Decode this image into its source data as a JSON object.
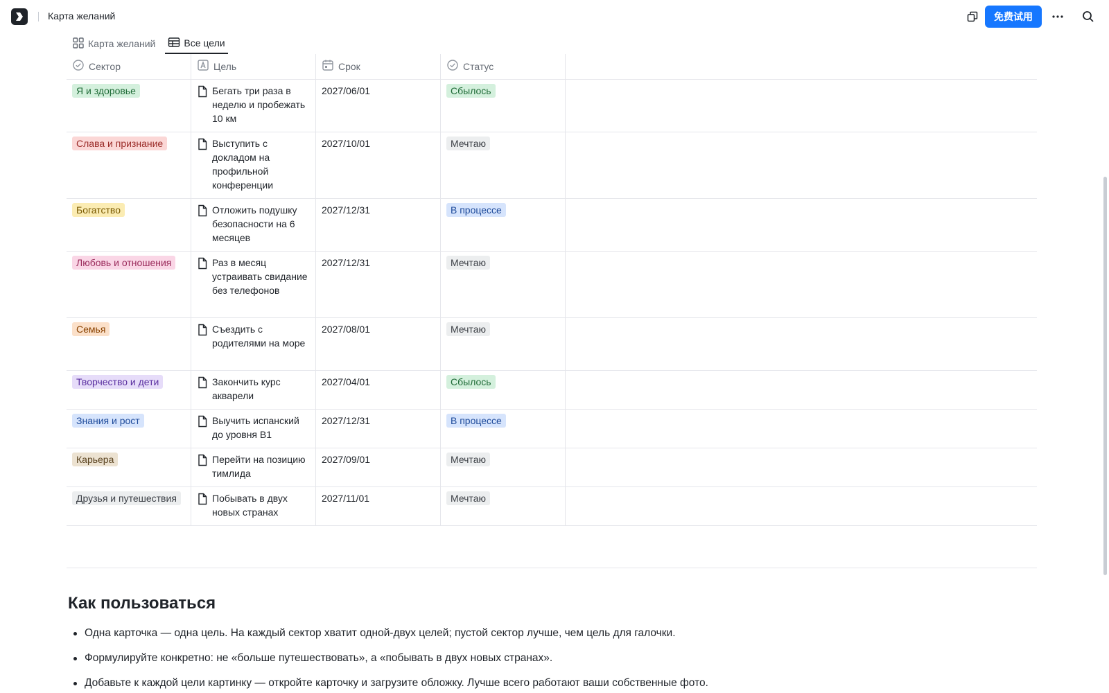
{
  "header": {
    "title": "Карта желаний",
    "try_button": "免费试用",
    "icons": [
      "app-logo-icon",
      "duplicate-icon",
      "more-icon",
      "search-icon"
    ]
  },
  "tabs": [
    {
      "label": "Карта желаний",
      "icon": "grid-icon",
      "active": false
    },
    {
      "label": "Все цели",
      "icon": "table-icon",
      "active": true
    }
  ],
  "table": {
    "columns": [
      {
        "label": "Сектор",
        "icon": "check-circle-icon"
      },
      {
        "label": "Цель",
        "icon": "text-field-icon"
      },
      {
        "label": "Срок",
        "icon": "calendar-icon"
      },
      {
        "label": "Статус",
        "icon": "check-circle-icon"
      }
    ],
    "rows": [
      {
        "sector": "Я и здоровье",
        "sector_color": "#d4f0dd",
        "sector_text": "#1f6b37",
        "goal": "Бегать три раза в неделю и пробежать 10 км",
        "date": "2027/06/01",
        "status": "Сбылось",
        "status_key": "done"
      },
      {
        "sector": "Слава и признание",
        "sector_color": "#fbd7d6",
        "sector_text": "#9a2a27",
        "goal": "Выступить с докладом на профильной конференции",
        "date": "2027/10/01",
        "status": "Мечтаю",
        "status_key": "dream"
      },
      {
        "sector": "Богатство",
        "sector_color": "#fbecb3",
        "sector_text": "#7a5a00",
        "goal": "Отложить подушку безопасности на 6 месяцев",
        "date": "2027/12/31",
        "status": "В процессе",
        "status_key": "progress"
      },
      {
        "sector": "Любовь и отношения",
        "sector_color": "#fad6e6",
        "sector_text": "#9a2a5b",
        "goal": "Раз в месяц устраивать свидание без телефонов",
        "date": "2027/12/31",
        "status": "Мечтаю",
        "status_key": "dream"
      },
      {
        "sector": "Семья",
        "sector_color": "#fbe0c9",
        "sector_text": "#8a4200",
        "goal": "Съездить с родителями на море",
        "date": "2027/08/01",
        "status": "Мечтаю",
        "status_key": "dream"
      },
      {
        "sector": "Творчество и дети",
        "sector_color": "#e6dcf9",
        "sector_text": "#5a2fa0",
        "goal": "Закончить курс акварели",
        "date": "2027/04/01",
        "status": "Сбылось",
        "status_key": "done"
      },
      {
        "sector": "Знания и рост",
        "sector_color": "#d6e4fc",
        "sector_text": "#1d4a9a",
        "goal": "Выучить испанский до уровня B1",
        "date": "2027/12/31",
        "status": "В процессе",
        "status_key": "progress"
      },
      {
        "sector": "Карьера",
        "sector_color": "#ece2d1",
        "sector_text": "#5a4320",
        "goal": "Перейти на позицию тимлида",
        "date": "2027/09/01",
        "status": "Мечтаю",
        "status_key": "dream"
      },
      {
        "sector": "Друзья и путешествия",
        "sector_color": "#eceeef",
        "sector_text": "#3b3f45",
        "goal": "Побывать в двух новых странах",
        "date": "2027/11/01",
        "status": "Мечтаю",
        "status_key": "dream"
      }
    ],
    "status_colors": {
      "done": {
        "bg": "#d4f0dd",
        "fg": "#1f6b37"
      },
      "dream": {
        "bg": "#eceeef",
        "fg": "#3b3f45"
      },
      "progress": {
        "bg": "#d6e4fc",
        "fg": "#1d4a9a"
      }
    }
  },
  "howto": {
    "title": "Как пользоваться",
    "items": [
      "Одна карточка — одна цель. На каждый сектор хватит одной-двух целей; пустой сектор лучше, чем цель для галочки.",
      "Формулируйте конкретно: не «больше путешествовать», а «побывать в двух новых странах».",
      "Добавьте к каждой цели картинку — откройте карточку и загрузите обложку. Лучше всего работают ваши собственные фото."
    ]
  },
  "accent_color": "#1677ff"
}
